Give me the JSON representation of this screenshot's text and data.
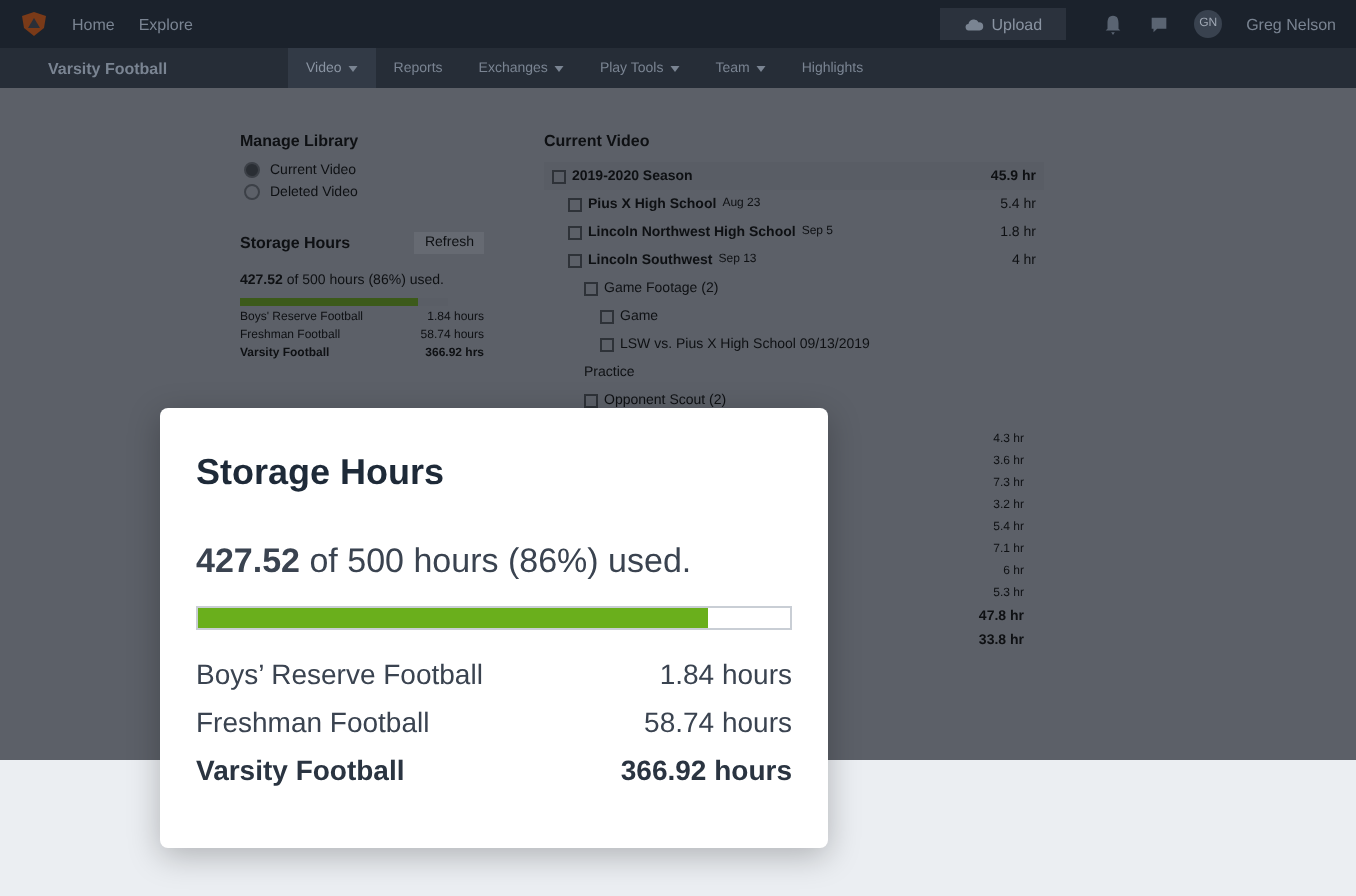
{
  "nav": {
    "links": [
      "Home",
      "Explore"
    ],
    "upload": "Upload",
    "user": {
      "initials": "GN",
      "name": "Greg Nelson"
    }
  },
  "subnav": {
    "team": "Varsity Football",
    "tabs": [
      {
        "label": "Video",
        "selected": true,
        "dropdown": true
      },
      {
        "label": "Reports",
        "selected": false,
        "dropdown": false
      },
      {
        "label": "Exchanges",
        "selected": false,
        "dropdown": true
      },
      {
        "label": "Play Tools",
        "selected": false,
        "dropdown": true
      },
      {
        "label": "Team",
        "selected": false,
        "dropdown": true
      },
      {
        "label": "Highlights",
        "selected": false,
        "dropdown": false
      }
    ]
  },
  "library": {
    "title": "Manage Library",
    "options": [
      {
        "label": "Current Video",
        "selected": true
      },
      {
        "label": "Deleted Video",
        "selected": false
      }
    ]
  },
  "storage_panel": {
    "title": "Storage Hours",
    "refresh": "Refresh",
    "summary": "**427.52** of 500 hours (86%) used.",
    "level": 0.86,
    "rows": [
      {
        "team": "Boys' Reserve Football",
        "hours": "1.84 hours",
        "bold": false
      },
      {
        "team": "Freshman Football",
        "hours": "58.74 hours",
        "bold": false
      },
      {
        "team": "Varsity Football",
        "hours": "366.92 hrs",
        "bold": true
      }
    ]
  },
  "current_video": {
    "title": "Current Video",
    "tree": [
      {
        "label": "2019-2020 Season",
        "hours": "45.9 hr",
        "bold": true,
        "children": [
          {
            "label": "Pius X High School",
            "date": "Aug 23",
            "hours": "5.4 hr"
          },
          {
            "label": "Lincoln Northwest High School",
            "date": "Sep 5",
            "hours": "1.8 hr"
          },
          {
            "label": "Lincoln Southwest",
            "date": "Sep 13",
            "hours": "4 hr",
            "children": [
              {
                "label": "Game Footage (2)",
                "children": [
                  {
                    "label": "Game"
                  },
                  {
                    "label": "LSW vs. Pius X High School 09/13/2019"
                  }
                ]
              },
              {
                "label": "Practice",
                "kind": "text"
              },
              {
                "label": "Opponent Scout (2)"
              }
            ]
          }
        ]
      }
    ],
    "more_hours": [
      {
        "hours": "4.3 hr",
        "bold": false
      },
      {
        "hours": "3.6 hr",
        "bold": false
      },
      {
        "hours": "7.3 hr",
        "bold": false
      },
      {
        "hours": "3.2 hr",
        "bold": false
      },
      {
        "hours": "5.4 hr",
        "bold": false
      },
      {
        "hours": "7.1 hr",
        "bold": false
      },
      {
        "hours": "6 hr",
        "bold": false
      },
      {
        "hours": "5.3 hr",
        "bold": false
      },
      {
        "hours": "47.8 hr",
        "bold": true
      },
      {
        "hours": "33.8 hr",
        "bold": true
      }
    ]
  },
  "dialog": {
    "title": "Storage Hours",
    "summary": "**427.52** of 500 hours (86%) used.",
    "level": 0.86,
    "rows": [
      {
        "team": "Boys’ Reserve Football",
        "hours": "1.84 hours",
        "bold": false
      },
      {
        "team": "Freshman Football",
        "hours": "58.74 hours",
        "bold": false
      },
      {
        "team": "Varsity Football",
        "hours": "366.92 hours",
        "bold": true
      }
    ]
  }
}
